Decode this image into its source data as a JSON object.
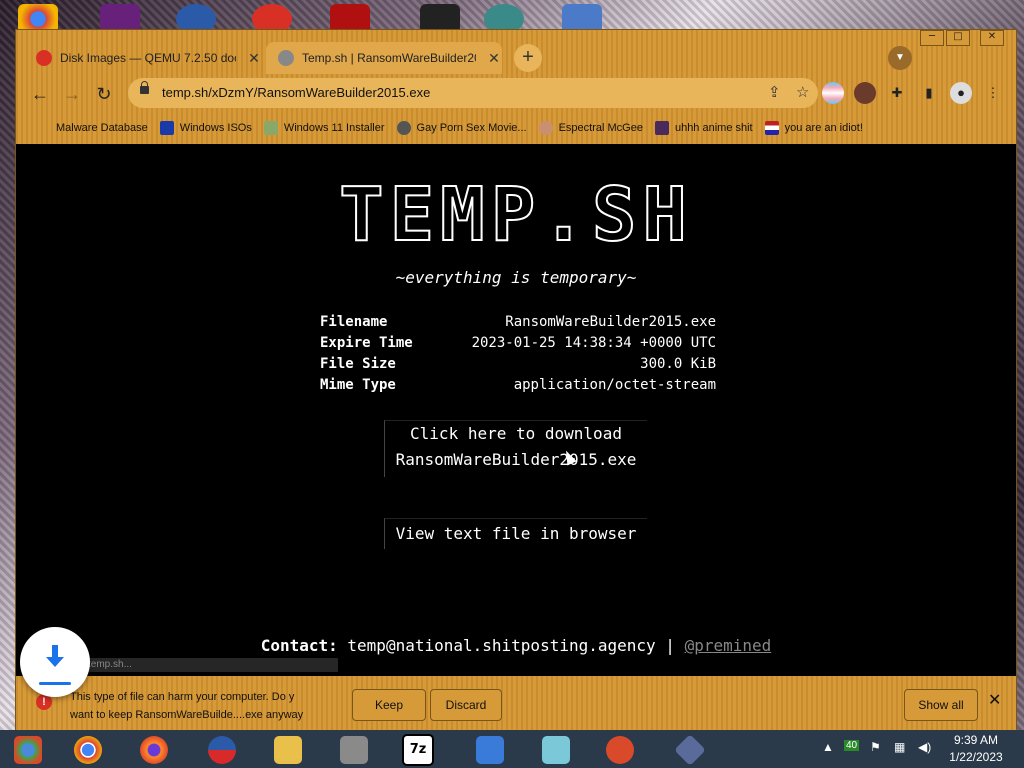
{
  "browser": {
    "tabs": [
      {
        "title": "Disk Images — QEMU 7.2.50 doc",
        "icon": "qemu-icon"
      },
      {
        "title": "Temp.sh | RansomWareBuilder20",
        "icon": "globe-icon"
      }
    ],
    "url": "temp.sh/xDzmY/RansomWareBuilder2015.exe",
    "bookmarks": [
      {
        "label": "Malware Database",
        "icon": "folder-icon"
      },
      {
        "label": "Windows ISOs",
        "icon": "x-icon"
      },
      {
        "label": "Windows 11 Installer",
        "icon": "image-icon"
      },
      {
        "label": "Gay Porn Sex Movie...",
        "icon": "face-icon"
      },
      {
        "label": "Espectral McGee",
        "icon": "face-icon"
      },
      {
        "label": "uhhh anime shit",
        "icon": "anime-icon"
      },
      {
        "label": "you are an idiot!",
        "icon": "flag-icon"
      }
    ]
  },
  "page": {
    "logo": "TEMP.SH",
    "tagline": "~everything is temporary~",
    "info": [
      {
        "key": "Filename",
        "value": "RansomWareBuilder2015.exe"
      },
      {
        "key": "Expire Time",
        "value": "2023-01-25 14:38:34 +0000 UTC"
      },
      {
        "key": "File Size",
        "value": "300.0 KiB"
      },
      {
        "key": "Mime Type",
        "value": "application/octet-stream"
      }
    ],
    "download_line1": "Click here to download",
    "download_line2": "RansomWareBuilder2015.exe",
    "view_text": "View text file in browser",
    "contact_label": "Contact:",
    "contact_email": "temp@national.shitposting.agency",
    "contact_sep": "|",
    "contact_handle": "@premined"
  },
  "shelf": {
    "download_name": "temp.sh...",
    "warning_line1": "This type of file can harm your computer. Do y",
    "warning_line2": "want to keep RansomWareBuilde....exe anyway",
    "keep": "Keep",
    "discard": "Discard",
    "show_all": "Show all"
  },
  "taskbar": {
    "time": "9:39 AM",
    "date": "1/22/2023",
    "badge": "40"
  },
  "colors": {
    "chrome": "#d09030",
    "page_bg": "#000000",
    "taskbar": "#2a3a4a",
    "warning": "#d93025"
  }
}
